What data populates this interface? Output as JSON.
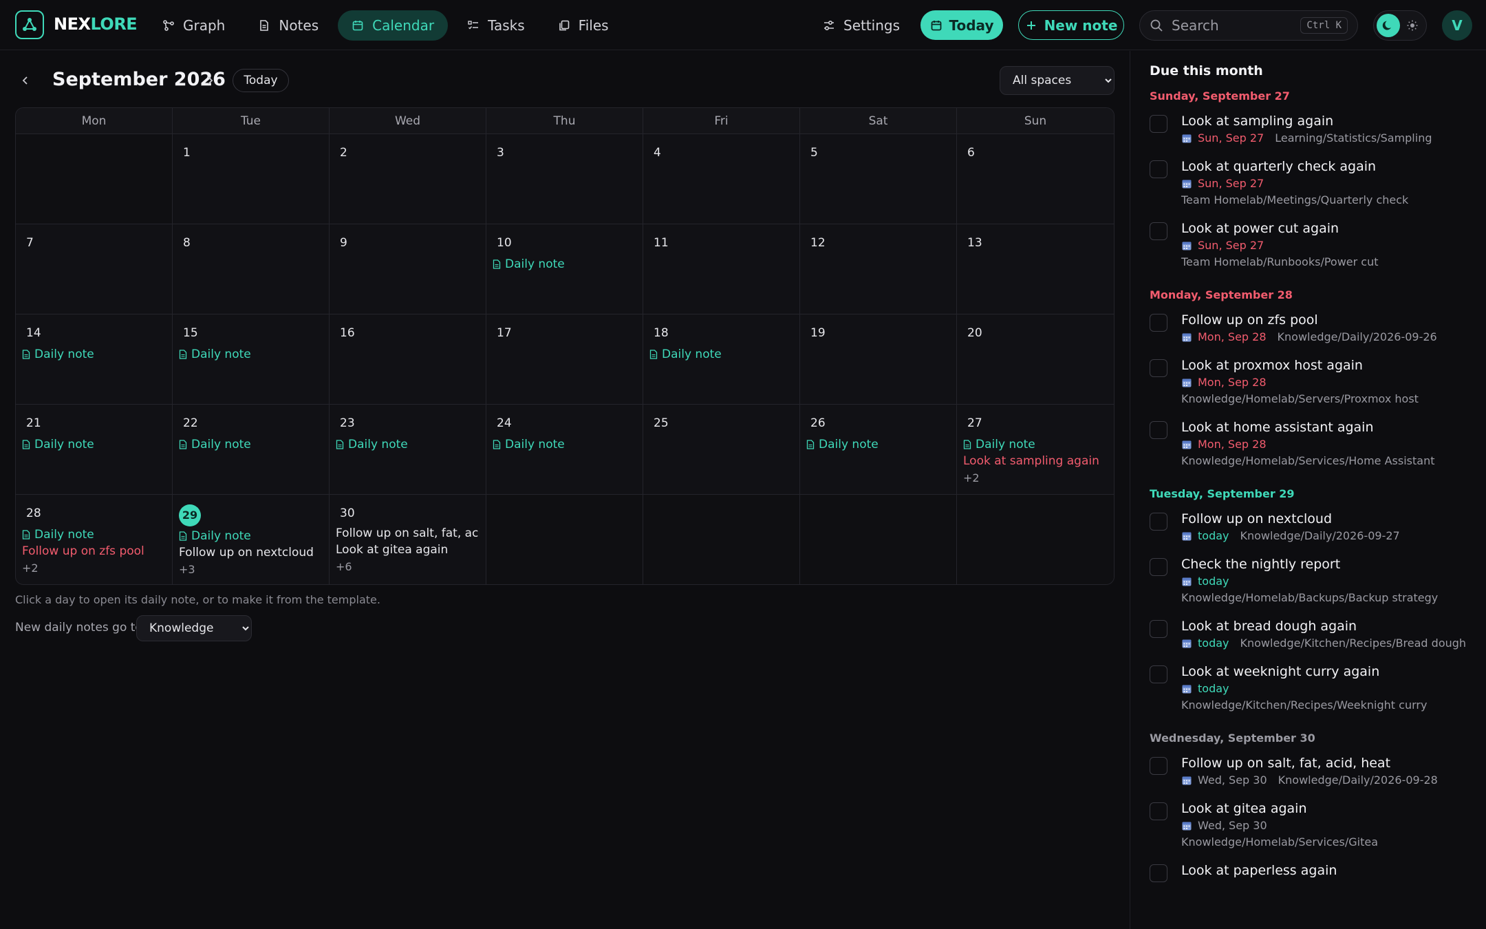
{
  "brand": {
    "name_a": "NEX",
    "name_b": "LORE"
  },
  "nav": [
    {
      "label": "Graph",
      "icon": "graph-icon",
      "active": false
    },
    {
      "label": "Notes",
      "icon": "note-icon",
      "active": false
    },
    {
      "label": "Calendar",
      "icon": "calendar-icon",
      "active": true
    },
    {
      "label": "Tasks",
      "icon": "tasks-icon",
      "active": false
    },
    {
      "label": "Files",
      "icon": "files-icon",
      "active": false
    }
  ],
  "toolbar": {
    "settings_label": "Settings",
    "today_label": "Today",
    "new_note_label": "New note"
  },
  "search": {
    "placeholder": "Search",
    "shortcut": "Ctrl K"
  },
  "user": {
    "initial": "V"
  },
  "colors": {
    "accent": "#3fd9b9",
    "overdue": "#f25c6e",
    "background": "#0d0d10"
  },
  "calendar": {
    "month_title": "September 2026",
    "today_button": "Today",
    "space_filter": "All spaces",
    "weekdays": [
      "Mon",
      "Tue",
      "Wed",
      "Thu",
      "Fri",
      "Sat",
      "Sun"
    ],
    "cells": [
      {
        "day": "",
        "events": []
      },
      {
        "day": "1",
        "events": []
      },
      {
        "day": "2",
        "events": []
      },
      {
        "day": "3",
        "events": []
      },
      {
        "day": "4",
        "events": []
      },
      {
        "day": "5",
        "events": []
      },
      {
        "day": "6",
        "events": []
      },
      {
        "day": "7",
        "events": []
      },
      {
        "day": "8",
        "events": []
      },
      {
        "day": "9",
        "events": []
      },
      {
        "day": "10",
        "events": [
          {
            "type": "note",
            "text": "Daily note"
          }
        ]
      },
      {
        "day": "11",
        "events": []
      },
      {
        "day": "12",
        "events": []
      },
      {
        "day": "13",
        "events": []
      },
      {
        "day": "14",
        "events": [
          {
            "type": "note",
            "text": "Daily note"
          }
        ]
      },
      {
        "day": "15",
        "events": [
          {
            "type": "note",
            "text": "Daily note"
          }
        ]
      },
      {
        "day": "16",
        "events": []
      },
      {
        "day": "17",
        "events": []
      },
      {
        "day": "18",
        "events": [
          {
            "type": "note",
            "text": "Daily note"
          }
        ]
      },
      {
        "day": "19",
        "events": []
      },
      {
        "day": "20",
        "events": []
      },
      {
        "day": "21",
        "events": [
          {
            "type": "note",
            "text": "Daily note"
          }
        ]
      },
      {
        "day": "22",
        "events": [
          {
            "type": "note",
            "text": "Daily note"
          }
        ]
      },
      {
        "day": "23",
        "events": [
          {
            "type": "note",
            "text": "Daily note"
          }
        ]
      },
      {
        "day": "24",
        "events": [
          {
            "type": "note",
            "text": "Daily note"
          }
        ]
      },
      {
        "day": "25",
        "events": []
      },
      {
        "day": "26",
        "events": [
          {
            "type": "note",
            "text": "Daily note"
          }
        ]
      },
      {
        "day": "27",
        "events": [
          {
            "type": "note",
            "text": "Daily note"
          },
          {
            "type": "overdue",
            "text": "Look at sampling again"
          },
          {
            "type": "more",
            "text": "+2"
          }
        ]
      },
      {
        "day": "28",
        "events": [
          {
            "type": "note",
            "text": "Daily note"
          },
          {
            "type": "overdue",
            "text": "Follow up on zfs pool"
          },
          {
            "type": "more",
            "text": "+2"
          }
        ]
      },
      {
        "day": "29",
        "today": true,
        "events": [
          {
            "type": "note",
            "text": "Daily note"
          },
          {
            "type": "task",
            "text": "Follow up on nextcloud"
          },
          {
            "type": "more",
            "text": "+3"
          }
        ]
      },
      {
        "day": "30",
        "events": [
          {
            "type": "task",
            "text": "Follow up on salt, fat, aci..."
          },
          {
            "type": "task",
            "text": "Look at gitea again"
          },
          {
            "type": "more",
            "text": "+6"
          }
        ]
      },
      {
        "day": "",
        "events": []
      },
      {
        "day": "",
        "events": []
      },
      {
        "day": "",
        "events": []
      },
      {
        "day": "",
        "events": []
      }
    ],
    "hint": "Click a day to open its daily note, or to make it from the template.",
    "destination_label": "New daily notes go to",
    "destination_value": "Knowledge"
  },
  "due": {
    "title": "Due this month",
    "groups": [
      {
        "heading": "Sunday, September 27",
        "tone": "red",
        "tasks": [
          {
            "title": "Look at sampling again",
            "due": "Sun, Sep 27",
            "path": "Learning/Statistics/Sampling"
          },
          {
            "title": "Look at quarterly check again",
            "due": "Sun, Sep 27",
            "path": "Team Homelab/Meetings/Quarterly check"
          },
          {
            "title": "Look at power cut again",
            "due": "Sun, Sep 27",
            "path": "Team Homelab/Runbooks/Power cut"
          }
        ]
      },
      {
        "heading": "Monday, September 28",
        "tone": "red",
        "tasks": [
          {
            "title": "Follow up on zfs pool",
            "due": "Mon, Sep 28",
            "path": "Knowledge/Daily/2026-09-26"
          },
          {
            "title": "Look at proxmox host again",
            "due": "Mon, Sep 28",
            "path": "Knowledge/Homelab/Servers/Proxmox host"
          },
          {
            "title": "Look at home assistant again",
            "due": "Mon, Sep 28",
            "path": "Knowledge/Homelab/Services/Home Assistant"
          }
        ]
      },
      {
        "heading": "Tuesday, September 29",
        "tone": "green",
        "tasks": [
          {
            "title": "Follow up on nextcloud",
            "due": "today",
            "path": "Knowledge/Daily/2026-09-27"
          },
          {
            "title": "Check the nightly report",
            "due": "today",
            "path": "Knowledge/Homelab/Backups/Backup strategy"
          },
          {
            "title": "Look at bread dough again",
            "due": "today",
            "path": "Knowledge/Kitchen/Recipes/Bread dough"
          },
          {
            "title": "Look at weeknight curry again",
            "due": "today",
            "path": "Knowledge/Kitchen/Recipes/Weeknight curry"
          }
        ]
      },
      {
        "heading": "Wednesday, September 30",
        "tone": "gray",
        "tasks": [
          {
            "title": "Follow up on salt, fat, acid, heat",
            "due": "Wed, Sep 30",
            "path": "Knowledge/Daily/2026-09-28"
          },
          {
            "title": "Look at gitea again",
            "due": "Wed, Sep 30",
            "path": "Knowledge/Homelab/Services/Gitea"
          },
          {
            "title": "Look at paperless again",
            "due": "",
            "path": ""
          }
        ]
      }
    ]
  }
}
